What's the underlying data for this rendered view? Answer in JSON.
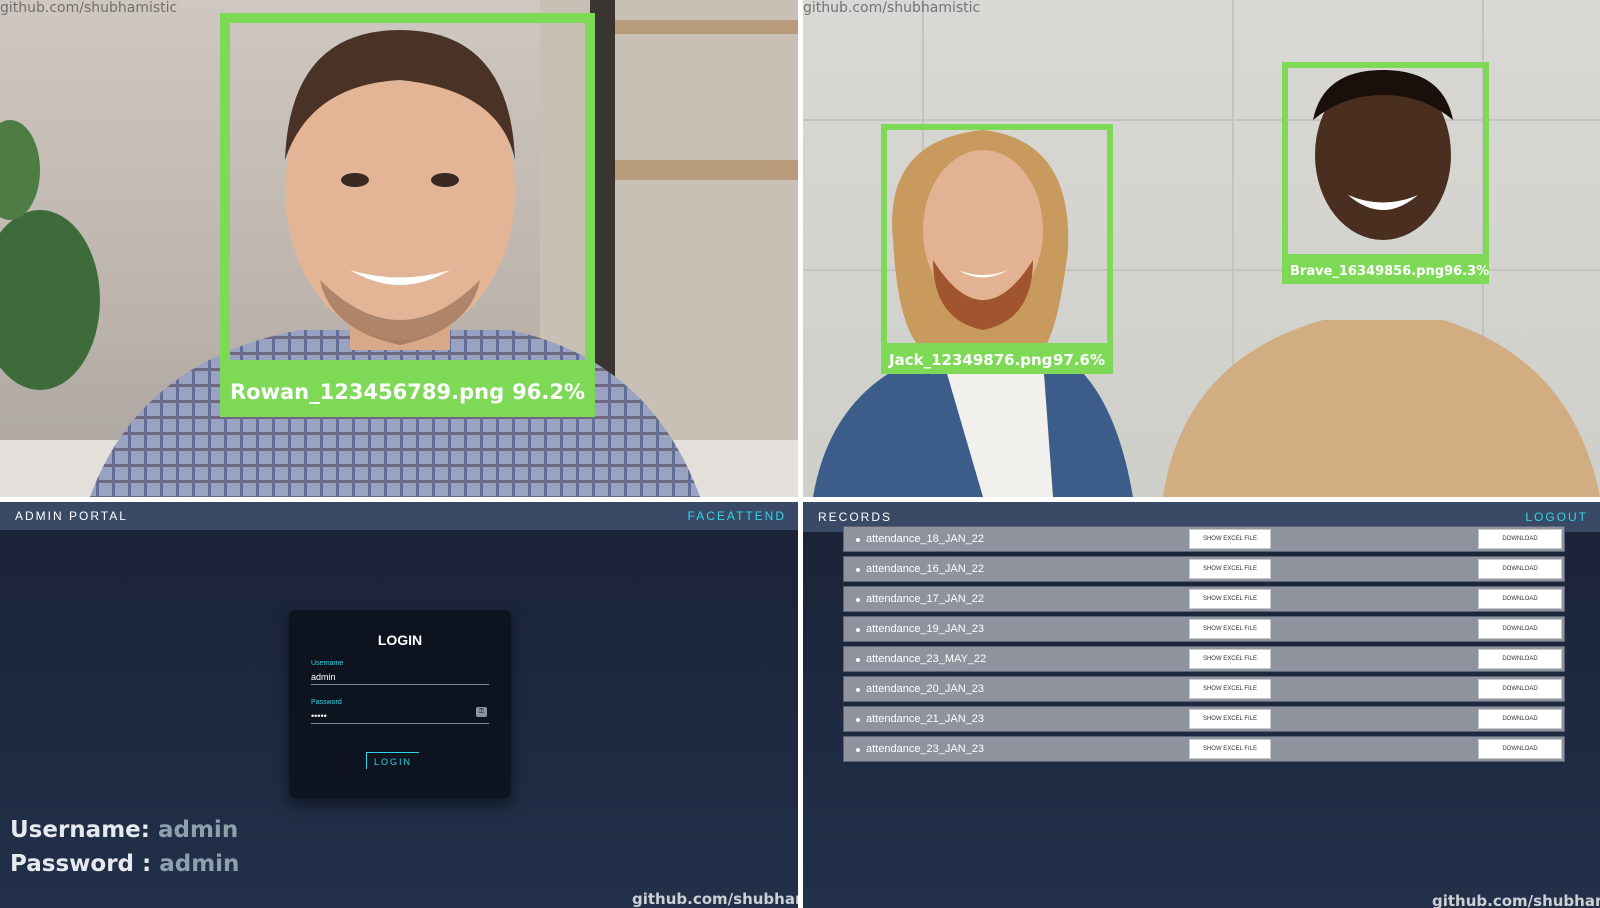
{
  "watermark": "github.com/shubhamistic",
  "detections_photo1": [
    {
      "name": "Rowan_123456789.png",
      "confidence": "96.2%"
    }
  ],
  "detections_photo2": [
    {
      "name": "Jack_12349876.png",
      "confidence": "97.6%"
    },
    {
      "name": "Brave_16349856.png",
      "confidence": "96.3%"
    }
  ],
  "box_color": "#7ed957",
  "admin": {
    "title": "ADMIN PORTAL",
    "brand": "FACEATTEND",
    "login_title": "LOGIN",
    "username_label": "Username",
    "username_value": "admin",
    "password_label": "Password",
    "password_value": "•••••",
    "login_button": "LOGIN",
    "creds_username_label": "Username:",
    "creds_username_value": "admin",
    "creds_password_label": "Password :",
    "creds_password_value": "admin"
  },
  "records": {
    "title": "RECORDS",
    "logout": "LOGOUT",
    "show_label": "SHOW EXCEL FILE",
    "download_label": "DOWNLOAD",
    "files": [
      "attendance_18_JAN_22",
      "attendance_16_JAN_22",
      "attendance_17_JAN_22",
      "attendance_19_JAN_23",
      "attendance_23_MAY_22",
      "attendance_20_JAN_23",
      "attendance_21_JAN_23",
      "attendance_23_JAN_23"
    ]
  },
  "accent_color": "#2dd6e8"
}
